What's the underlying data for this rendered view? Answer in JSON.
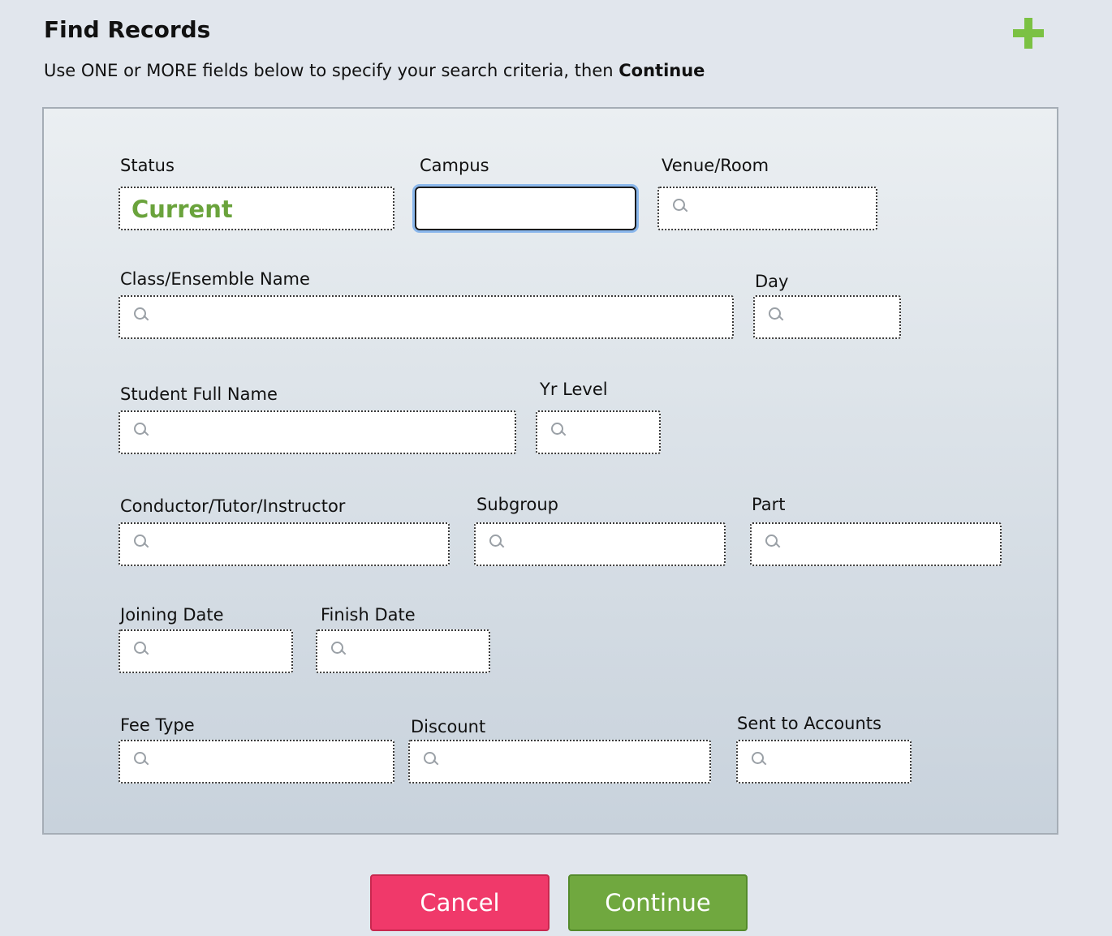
{
  "header": {
    "title": "Find Records",
    "instructions": "Use ONE or MORE fields below to specify your search criteria, then",
    "instructions_bold": "Continue",
    "add_icon": "plus-icon"
  },
  "colors": {
    "accent_green": "#6aa33c",
    "cancel_red": "#f0396a",
    "continue_green": "#70a83f"
  },
  "form": {
    "status": {
      "label": "Status",
      "value": "Current"
    },
    "campus": {
      "label": "Campus",
      "value": ""
    },
    "venue_room": {
      "label": "Venue/Room",
      "value": ""
    },
    "class_name": {
      "label": "Class/Ensemble Name",
      "value": ""
    },
    "day": {
      "label": "Day",
      "value": ""
    },
    "student_full_name": {
      "label": "Student Full Name",
      "value": ""
    },
    "yr_level": {
      "label": "Yr Level",
      "value": ""
    },
    "conductor": {
      "label": "Conductor/Tutor/Instructor",
      "value": ""
    },
    "subgroup": {
      "label": "Subgroup",
      "value": ""
    },
    "part": {
      "label": "Part",
      "value": ""
    },
    "joining_date": {
      "label": "Joining Date",
      "value": ""
    },
    "finish_date": {
      "label": "Finish Date",
      "value": ""
    },
    "fee_type": {
      "label": "Fee Type",
      "value": ""
    },
    "discount": {
      "label": "Discount",
      "value": ""
    },
    "sent_to_accounts": {
      "label": "Sent to Accounts",
      "value": ""
    }
  },
  "buttons": {
    "cancel": "Cancel",
    "continue": "Continue"
  }
}
